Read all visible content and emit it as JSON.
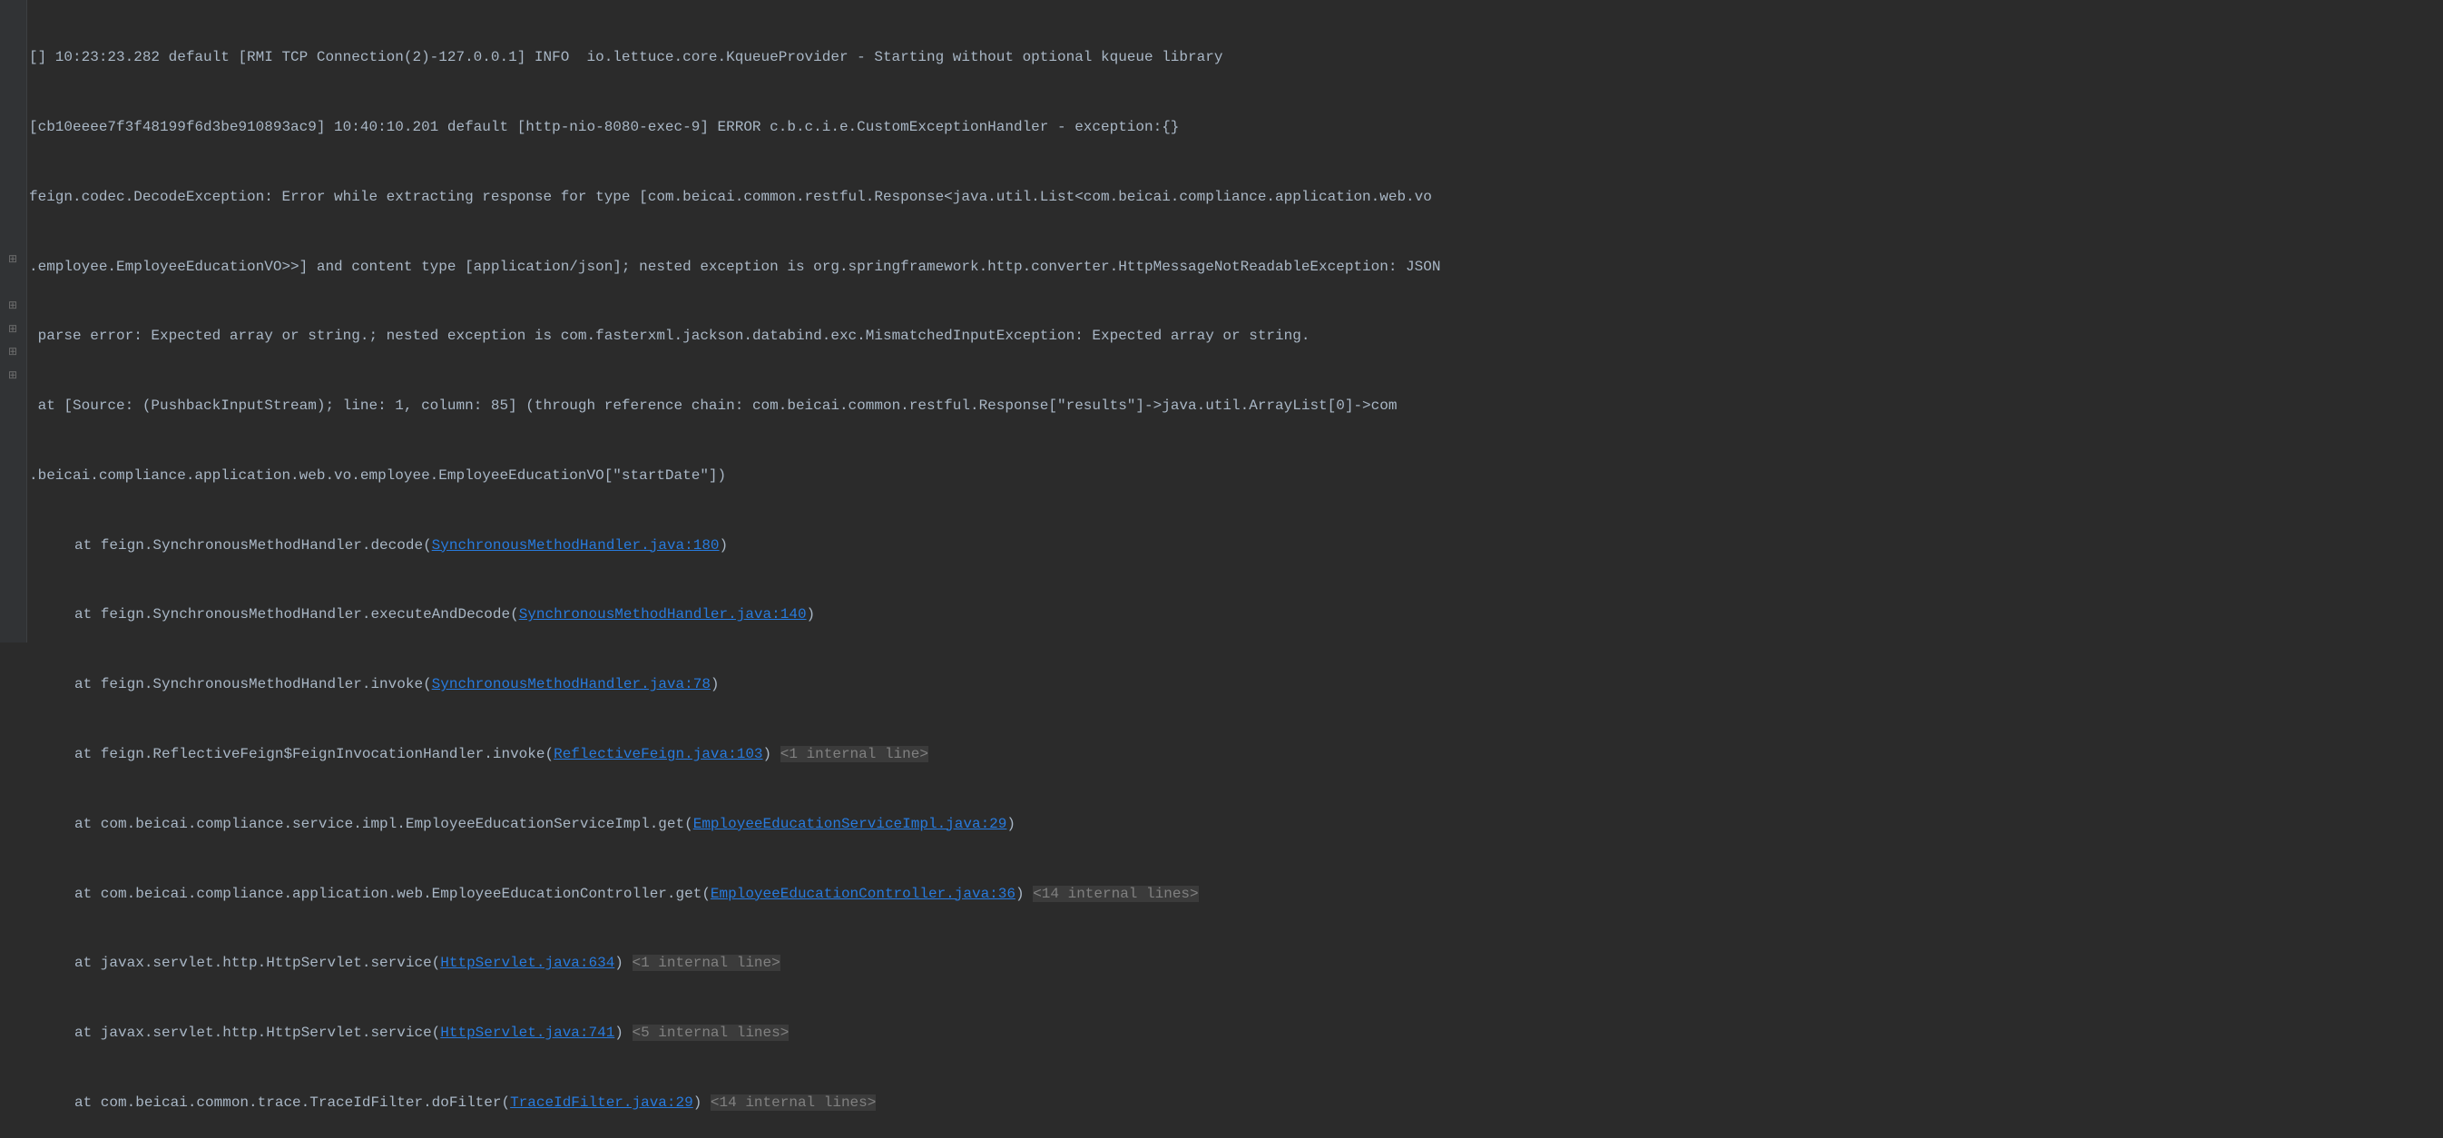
{
  "gutter": {
    "expand_icon": "⊞"
  },
  "log": {
    "line0": "[] 10:23:23.282 default [RMI TCP Connection(2)-127.0.0.1] INFO  io.lettuce.core.KqueueProvider - Starting without optional kqueue library",
    "line1": "[cb10eeee7f3f48199f6d3be910893ac9] 10:40:10.201 default [http-nio-8080-exec-9] ERROR c.b.c.i.e.CustomExceptionHandler - exception:{}",
    "line2_prefix": "feign.codec.DecodeException: Error while extracting response for type [com.beicai.common.restful.Response<java.util.List<com.beicai.compliance.application.web.vo",
    "line2_cont1": ".employee.EmployeeEducationVO>>] and content type [application/json]; nested exception is org.springframework.http.converter.HttpMessageNotReadableException: JSON",
    "line2_cont2": " parse error: Expected array or string.; nested exception is com.fasterxml.jackson.databind.exc.MismatchedInputException: Expected array or string.",
    "line3_prefix": " at [Source: (PushbackInputStream); line: 1, column: 85] (through reference chain: com.beicai.common.restful.Response[\"results\"]->java.util.ArrayList[0]->com",
    "line3_cont1": ".beicai.compliance.application.web.vo.employee.EmployeeEducationVO[\"startDate\"])",
    "st1_prefix": "at feign.SynchronousMethodHandler.decode(",
    "st1_link": "SynchronousMethodHandler.java:180",
    "st1_suffix": ")",
    "st2_prefix": "at feign.SynchronousMethodHandler.executeAndDecode(",
    "st2_link": "SynchronousMethodHandler.java:140",
    "st2_suffix": ")",
    "st3_prefix": "at feign.SynchronousMethodHandler.invoke(",
    "st3_link": "SynchronousMethodHandler.java:78",
    "st3_suffix": ")",
    "st4_prefix": "at feign.ReflectiveFeign$FeignInvocationHandler.invoke(",
    "st4_link": "ReflectiveFeign.java:103",
    "st4_suffix": ") ",
    "st4_internal": "<1 internal line>",
    "st5_prefix": "at com.beicai.compliance.service.impl.EmployeeEducationServiceImpl.get(",
    "st5_link": "EmployeeEducationServiceImpl.java:29",
    "st5_suffix": ")",
    "st6_prefix": "at com.beicai.compliance.application.web.EmployeeEducationController.get(",
    "st6_link": "EmployeeEducationController.java:36",
    "st6_suffix": ") ",
    "st6_internal": "<14 internal lines>",
    "st7_prefix": "at javax.servlet.http.HttpServlet.service(",
    "st7_link": "HttpServlet.java:634",
    "st7_suffix": ") ",
    "st7_internal": "<1 internal line>",
    "st8_prefix": "at javax.servlet.http.HttpServlet.service(",
    "st8_link": "HttpServlet.java:741",
    "st8_suffix": ") ",
    "st8_internal": "<5 internal lines>",
    "st9_prefix": "at com.beicai.common.trace.TraceIdFilter.doFilter(",
    "st9_link": "TraceIdFilter.java:29",
    "st9_suffix": ") ",
    "st9_internal": "<14 internal lines>"
  }
}
